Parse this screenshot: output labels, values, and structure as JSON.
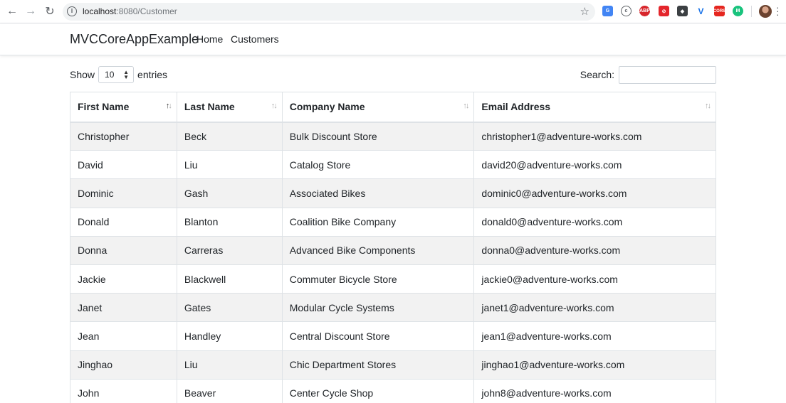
{
  "browser": {
    "url_host": "localhost",
    "url_rest": ":8080/Customer",
    "extensions": [
      "translate-icon",
      "circle-c-icon",
      "abp-icon",
      "flash-block-icon",
      "shield-icon",
      "v-icon",
      "cors-icon",
      "green-m-icon"
    ],
    "ext_labels": {
      "abp": "ABP",
      "cors": "CORS",
      "v": "V",
      "m": "M"
    }
  },
  "navbar": {
    "brand": "MVCCoreAppExample",
    "links": [
      {
        "label": "Home"
      },
      {
        "label": "Customers"
      }
    ]
  },
  "datatable": {
    "show_label": "Show",
    "page_length": "10",
    "entries_label": "entries",
    "search_label": "Search:",
    "search_value": "",
    "sorted_column": "First Name",
    "sort_direction": "ascending",
    "columns": [
      "First Name",
      "Last Name",
      "Company Name",
      "Email Address"
    ],
    "rows": [
      [
        "Christopher",
        "Beck",
        "Bulk Discount Store",
        "christopher1@adventure-works.com"
      ],
      [
        "David",
        "Liu",
        "Catalog Store",
        "david20@adventure-works.com"
      ],
      [
        "Dominic",
        "Gash",
        "Associated Bikes",
        "dominic0@adventure-works.com"
      ],
      [
        "Donald",
        "Blanton",
        "Coalition Bike Company",
        "donald0@adventure-works.com"
      ],
      [
        "Donna",
        "Carreras",
        "Advanced Bike Components",
        "donna0@adventure-works.com"
      ],
      [
        "Jackie",
        "Blackwell",
        "Commuter Bicycle Store",
        "jackie0@adventure-works.com"
      ],
      [
        "Janet",
        "Gates",
        "Modular Cycle Systems",
        "janet1@adventure-works.com"
      ],
      [
        "Jean",
        "Handley",
        "Central Discount Store",
        "jean1@adventure-works.com"
      ],
      [
        "Jinghao",
        "Liu",
        "Chic Department Stores",
        "jinghao1@adventure-works.com"
      ],
      [
        "John",
        "Beaver",
        "Center Cycle Shop",
        "john8@adventure-works.com"
      ]
    ]
  },
  "colors": {
    "stripe": "#f2f2f2",
    "border": "#dee2e6",
    "text": "#212529"
  }
}
